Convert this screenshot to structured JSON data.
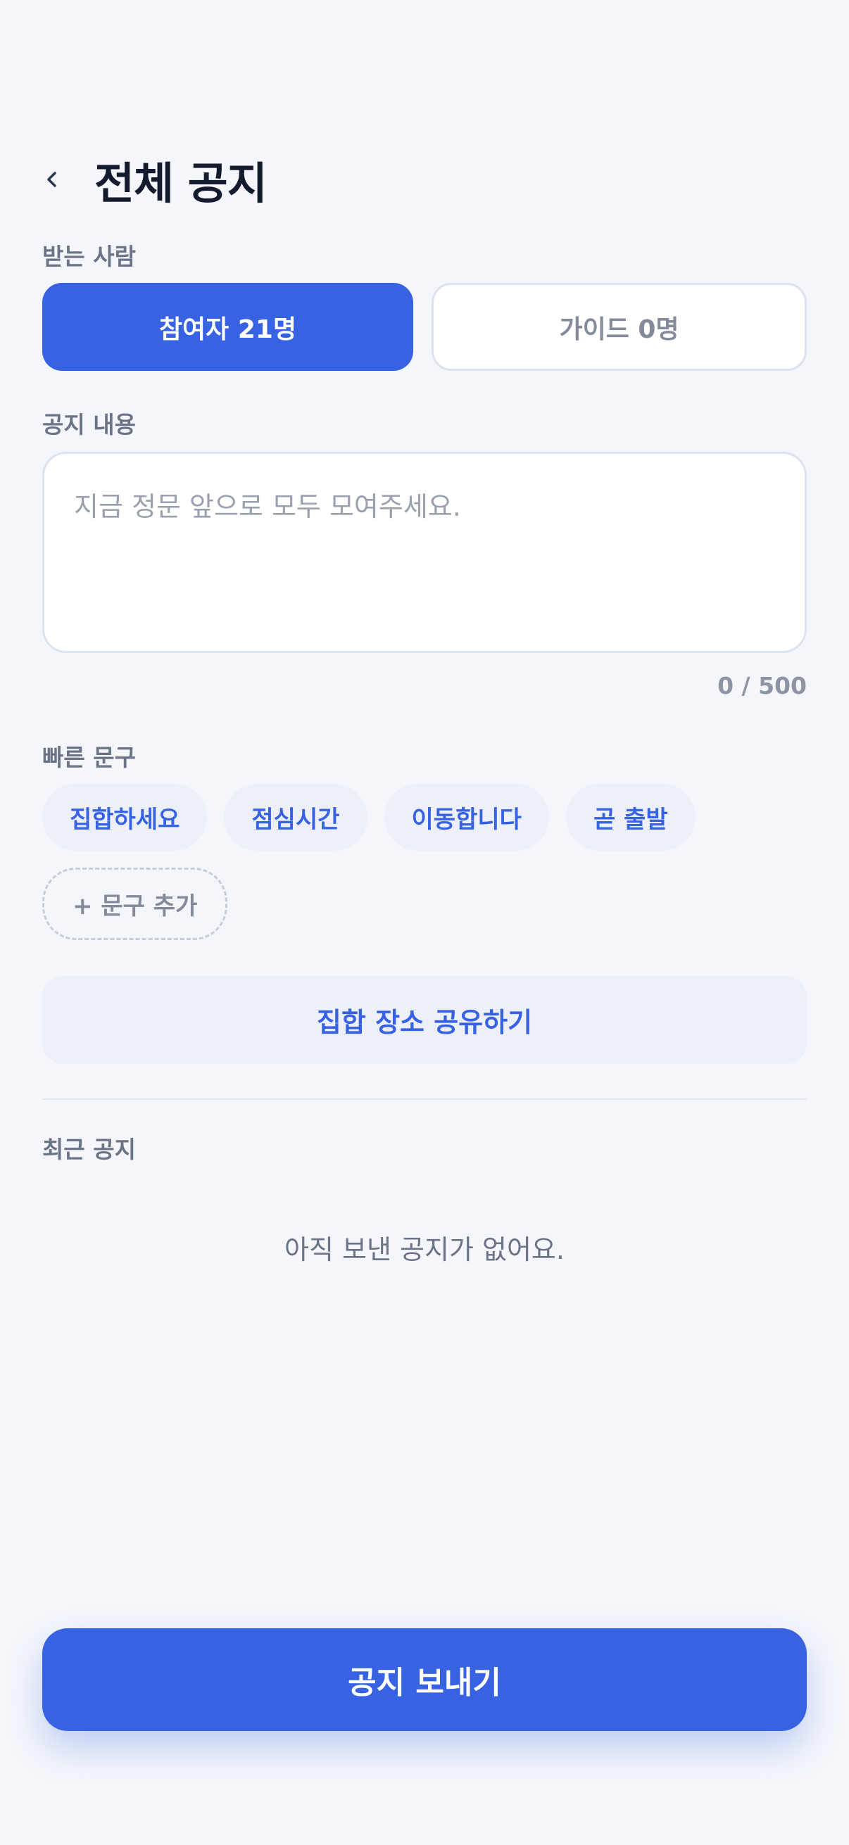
{
  "header": {
    "back_icon": "chevron-left-icon",
    "title": "전체 공지"
  },
  "recipients": {
    "label": "받는 사람",
    "participants_label": "참여자 21명",
    "guides_label": "가이드 0명",
    "selected": "participants"
  },
  "notice": {
    "label": "공지 내용",
    "value": "",
    "placeholder": "지금 정문 앞으로 모두 모여주세요.",
    "counter": "0 / 500"
  },
  "quick_phrases": {
    "label": "빠른 문구",
    "items": [
      "집합하세요",
      "점심시간",
      "이동합니다",
      "곧 출발"
    ],
    "add_label": "+ 문구 추가"
  },
  "share_location": {
    "label": "집합 장소 공유하기"
  },
  "recent": {
    "label": "최근 공지",
    "empty_text": "아직 보낸 공지가 없어요."
  },
  "send": {
    "label": "공지 보내기"
  },
  "colors": {
    "accent": "#3763e3",
    "background": "#f4f6fb",
    "chip_background": "#edf0f8",
    "muted_text": "#6b7486"
  }
}
